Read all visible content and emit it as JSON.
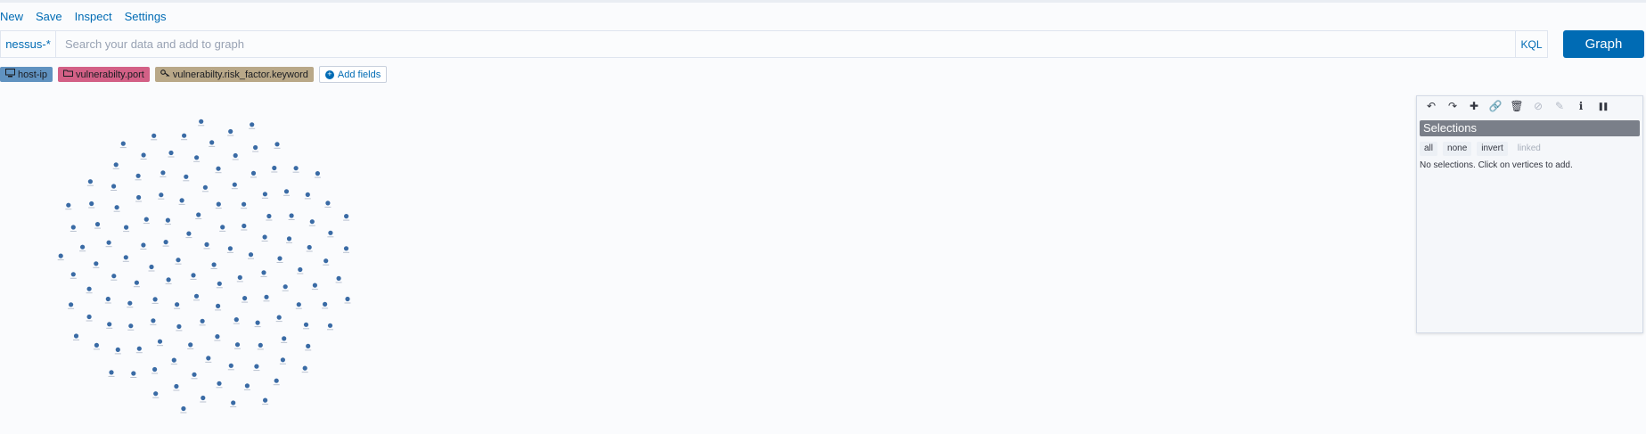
{
  "menu": [
    "New",
    "Save",
    "Inspect",
    "Settings"
  ],
  "search": {
    "index_pattern": "nessus-*",
    "placeholder": "Search your data and add to graph",
    "language": "KQL",
    "submit_label": "Graph"
  },
  "fields": [
    {
      "name": "host-ip",
      "color": "#6092c0",
      "icon": "computer-icon"
    },
    {
      "name": "vulnerabilty.port",
      "color": "#d36086",
      "icon": "folder-icon"
    },
    {
      "name": "vulnerabilty.risk_factor.keyword",
      "color": "#b9a888",
      "icon": "key-icon"
    }
  ],
  "add_fields_label": "Add fields",
  "graph": {
    "vertex_color": "#3a6ba5",
    "vertex_count": 137
  },
  "panel": {
    "tools": [
      {
        "name": "undo-icon",
        "glyph": "↶",
        "enabled": true
      },
      {
        "name": "redo-icon",
        "glyph": "↷",
        "enabled": true
      },
      {
        "name": "expand-icon",
        "glyph": "✚",
        "enabled": true
      },
      {
        "name": "link-icon",
        "glyph": "🔗",
        "enabled": true
      },
      {
        "name": "delete-icon",
        "glyph": "🗑",
        "enabled": true
      },
      {
        "name": "blacklist-icon",
        "glyph": "⊘",
        "enabled": false
      },
      {
        "name": "style-icon",
        "glyph": "✎",
        "enabled": false
      },
      {
        "name": "info-icon",
        "glyph": "ℹ",
        "enabled": true
      },
      {
        "name": "pause-icon",
        "glyph": "❚❚",
        "enabled": true
      }
    ],
    "title": "Selections",
    "buttons": [
      {
        "label": "all",
        "enabled": true
      },
      {
        "label": "none",
        "enabled": true
      },
      {
        "label": "invert",
        "enabled": true
      },
      {
        "label": "linked",
        "enabled": false
      }
    ],
    "info": "No selections. Click on vertices to add."
  }
}
